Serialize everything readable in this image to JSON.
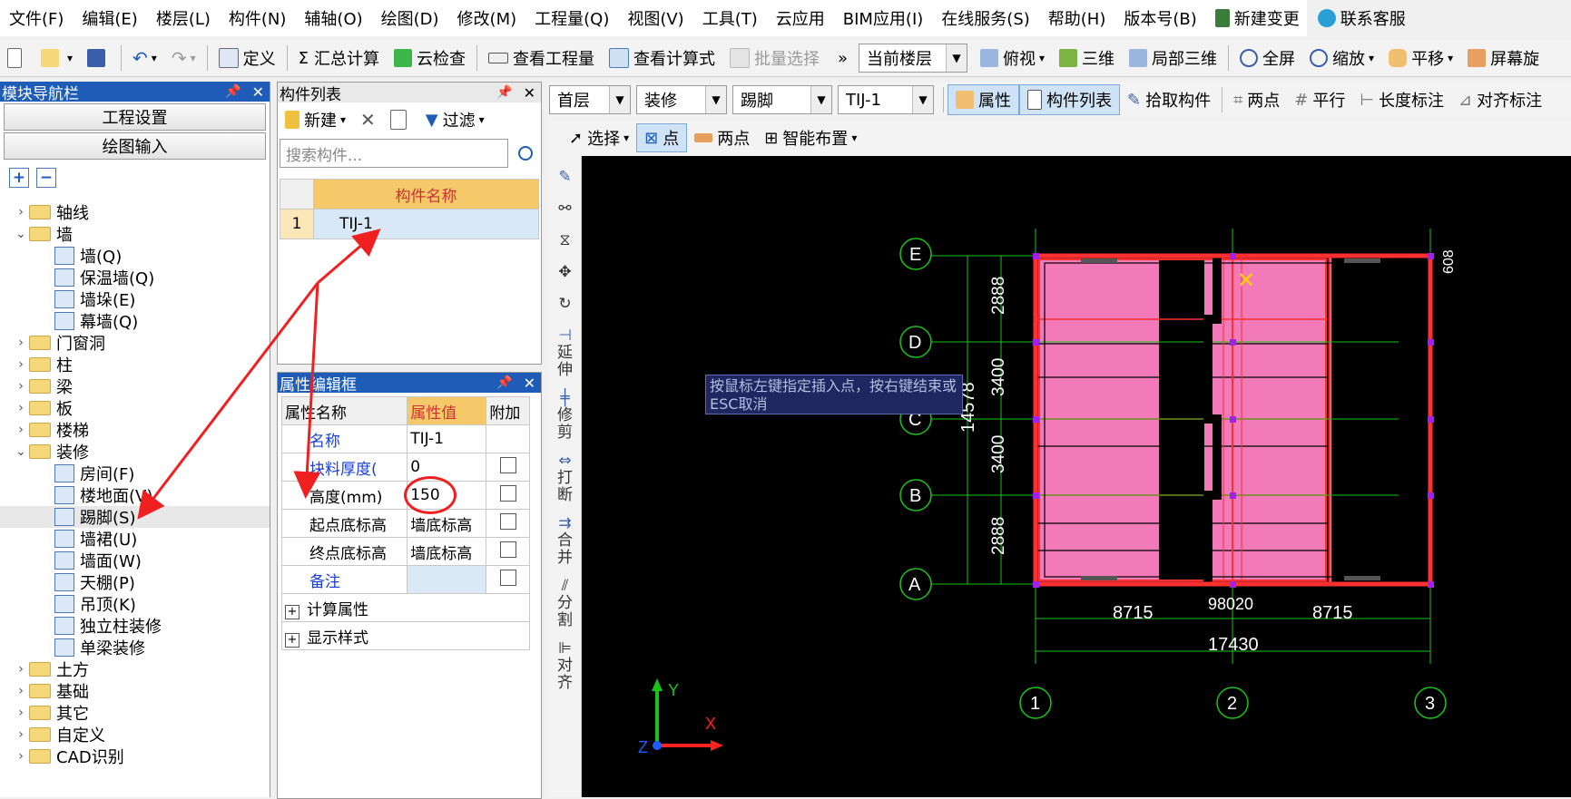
{
  "menu": [
    "文件(F)",
    "编辑(E)",
    "楼层(L)",
    "构件(N)",
    "辅轴(O)",
    "绘图(D)",
    "修改(M)",
    "工程量(Q)",
    "视图(V)",
    "工具(T)",
    "云应用",
    "BIM应用(I)",
    "在线服务(S)",
    "帮助(H)",
    "版本号(B)",
    "新建变更",
    "联系客服"
  ],
  "toolbar1": {
    "define": "定义",
    "sum": "汇总计算",
    "cloud_check": "云检查",
    "view_qty": "查看工程量",
    "view_formula": "查看计算式",
    "batch_select": "批量选择",
    "more": "»",
    "floor_select": "当前楼层",
    "top_view": "俯视",
    "three_d": "三维",
    "local_3d": "局部三维",
    "fullscreen": "全屏",
    "zoom": "缩放",
    "pan": "平移",
    "screen_rotate": "屏幕旋"
  },
  "nav": {
    "title": "模块导航栏",
    "project_settings": "工程设置",
    "drawing_input": "绘图输入",
    "tree": [
      {
        "label": "轴线",
        "level": 0,
        "expanded": false
      },
      {
        "label": "墙",
        "level": 0,
        "expanded": true
      },
      {
        "label": "墙(Q)",
        "level": 1
      },
      {
        "label": "保温墙(Q)",
        "level": 1
      },
      {
        "label": "墙垛(E)",
        "level": 1
      },
      {
        "label": "幕墙(Q)",
        "level": 1
      },
      {
        "label": "门窗洞",
        "level": 0,
        "expanded": false
      },
      {
        "label": "柱",
        "level": 0,
        "expanded": false
      },
      {
        "label": "梁",
        "level": 0,
        "expanded": false
      },
      {
        "label": "板",
        "level": 0,
        "expanded": false
      },
      {
        "label": "楼梯",
        "level": 0,
        "expanded": false
      },
      {
        "label": "装修",
        "level": 0,
        "expanded": true
      },
      {
        "label": "房间(F)",
        "level": 1
      },
      {
        "label": "楼地面(V)",
        "level": 1
      },
      {
        "label": "踢脚(S)",
        "level": 1,
        "selected": true
      },
      {
        "label": "墙裙(U)",
        "level": 1
      },
      {
        "label": "墙面(W)",
        "level": 1
      },
      {
        "label": "天棚(P)",
        "level": 1
      },
      {
        "label": "吊顶(K)",
        "level": 1
      },
      {
        "label": "独立柱装修",
        "level": 1
      },
      {
        "label": "单梁装修",
        "level": 1
      },
      {
        "label": "土方",
        "level": 0,
        "expanded": false
      },
      {
        "label": "基础",
        "level": 0,
        "expanded": false
      },
      {
        "label": "其它",
        "level": 0,
        "expanded": false
      },
      {
        "label": "自定义",
        "level": 0,
        "expanded": false
      },
      {
        "label": "CAD识别",
        "level": 0,
        "expanded": false
      }
    ]
  },
  "component_list": {
    "title": "构件列表",
    "new": "新建",
    "filter": "过滤",
    "search_placeholder": "搜索构件...",
    "col_header": "构件名称",
    "rows": [
      {
        "index": "1",
        "name": "TIJ-1"
      }
    ]
  },
  "properties": {
    "title": "属性编辑框",
    "headers": [
      "属性名称",
      "属性值",
      "附加"
    ],
    "rows": [
      {
        "name": "名称",
        "value": "TIJ-1",
        "blue": true,
        "checkbox": false
      },
      {
        "name": "块料厚度(",
        "value": "0",
        "blue": true,
        "checkbox": true
      },
      {
        "name": "高度(mm)",
        "value": "150",
        "blue": false,
        "checkbox": true
      },
      {
        "name": "起点底标高",
        "value": "墙底标高",
        "blue": false,
        "checkbox": true
      },
      {
        "name": "终点底标高",
        "value": "墙底标高",
        "blue": false,
        "checkbox": true
      },
      {
        "name": "备注",
        "value": "",
        "blue": true,
        "checkbox": true
      }
    ],
    "groups": [
      "计算属性",
      "显示样式"
    ]
  },
  "toolbar2": {
    "floor": "首层",
    "category": "装修",
    "type": "踢脚",
    "component": "TIJ-1",
    "attributes": "属性",
    "comp_list": "构件列表",
    "pick": "拾取构件",
    "two_points": "两点",
    "parallel": "平行",
    "length_dim": "长度标注",
    "align_dim": "对齐标注"
  },
  "toolbar3": {
    "select": "选择",
    "point": "点",
    "two_points": "两点",
    "smart_place": "智能布置"
  },
  "vtools": [
    "延伸",
    "修剪",
    "打断",
    "合并",
    "分割",
    "对齐"
  ],
  "tooltip": "按鼠标左键指定插入点，按右键结束或ESC取消",
  "drawing": {
    "axes_rows": [
      "E",
      "D",
      "C",
      "B",
      "A"
    ],
    "axes_cols": [
      "1",
      "2",
      "3"
    ],
    "dims_bottom": [
      "8715",
      "8715"
    ],
    "dim_total": "17430",
    "dim_center": "98020",
    "dim_left_total": "14578",
    "dim_left_parts": [
      "2888",
      "3400",
      "3400",
      "2888"
    ],
    "dim_top_right": "608",
    "ucs": {
      "x": "X",
      "y": "Y",
      "z": "Z"
    }
  },
  "colors": {
    "titlebar": "#1f5cb8",
    "room_fill": "#f27ab8",
    "wall": "#ff3030",
    "axis": "#19c419",
    "highlight": "#f5c96a"
  }
}
